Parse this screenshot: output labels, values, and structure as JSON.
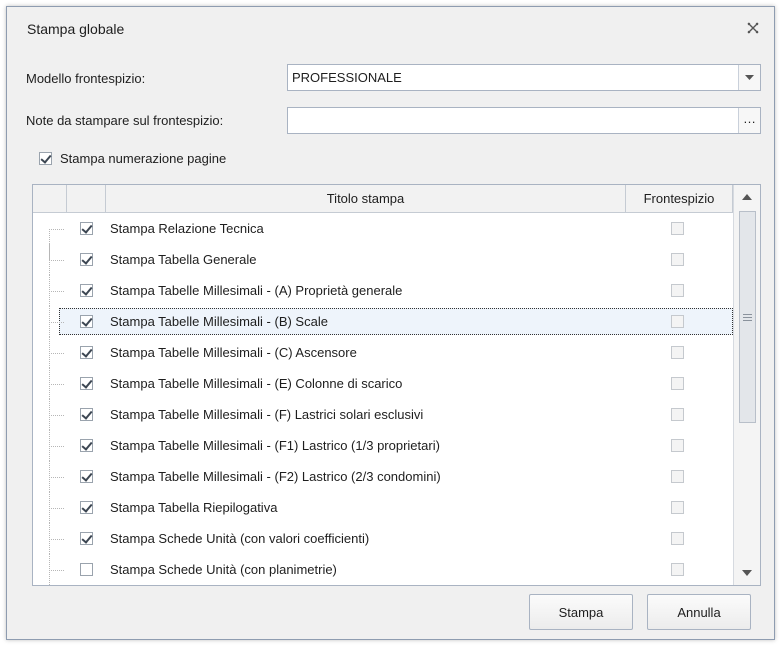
{
  "window": {
    "title": "Stampa globale"
  },
  "form": {
    "model_label": "Modello frontespizio:",
    "model_value": "PROFESSIONALE",
    "notes_label": "Note da stampare sul frontespizio:",
    "notes_value": "",
    "notes_button": "…",
    "page_numbering_label": "Stampa numerazione pagine",
    "page_numbering_checked": true
  },
  "grid": {
    "columns": [
      "Titolo stampa",
      "Frontespizio"
    ],
    "rows": [
      {
        "title": "Stampa Relazione Tecnica",
        "checked": true,
        "frontespizio": false
      },
      {
        "title": "Stampa Tabella Generale",
        "checked": true,
        "frontespizio": false
      },
      {
        "title": "Stampa Tabelle Millesimali - (A) Proprietà generale",
        "checked": true,
        "frontespizio": false
      },
      {
        "title": "Stampa Tabelle Millesimali - (B) Scale",
        "checked": true,
        "frontespizio": false,
        "selected": true
      },
      {
        "title": "Stampa Tabelle Millesimali - (C) Ascensore",
        "checked": true,
        "frontespizio": false
      },
      {
        "title": "Stampa Tabelle Millesimali - (E) Colonne di scarico",
        "checked": true,
        "frontespizio": false
      },
      {
        "title": "Stampa Tabelle Millesimali - (F) Lastrici solari esclusivi",
        "checked": true,
        "frontespizio": false
      },
      {
        "title": "Stampa Tabelle Millesimali - (F1) Lastrico (1/3 proprietari)",
        "checked": true,
        "frontespizio": false
      },
      {
        "title": "Stampa Tabelle Millesimali - (F2) Lastrico (2/3 condomini)",
        "checked": true,
        "frontespizio": false
      },
      {
        "title": "Stampa Tabella Riepilogativa",
        "checked": true,
        "frontespizio": false
      },
      {
        "title": "Stampa Schede Unità (con valori coefficienti)",
        "checked": true,
        "frontespizio": false
      },
      {
        "title": "Stampa Schede Unità (con planimetrie)",
        "checked": false,
        "frontespizio": false
      }
    ]
  },
  "buttons": {
    "print": "Stampa",
    "cancel": "Annulla"
  },
  "colors": {
    "selection_bg": "#eef4fb",
    "window_bg": "#f0f0f0",
    "border": "#a9b3c2"
  }
}
